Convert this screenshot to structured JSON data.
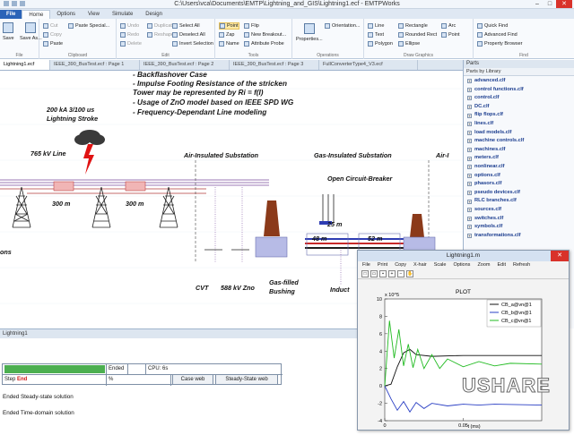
{
  "window": {
    "title": "C:\\Users\\vca\\Documents\\EMTP\\Lightning_and_GIS\\Lightning1.ecf - EMTPWorks",
    "controls": [
      "–",
      "□",
      "✕"
    ]
  },
  "ribbon": {
    "tabs": [
      "File",
      "Home",
      "Options",
      "View",
      "Simulate",
      "Design"
    ],
    "file_group": {
      "save": "Save",
      "save_as": "Save As...",
      "label": "File"
    },
    "clipboard": {
      "cut": "Cut",
      "copy": "Copy",
      "paste": "Paste",
      "paste_special": "Paste Special...",
      "label": "Clipboard"
    },
    "edit": {
      "undo": "Undo",
      "redo": "Redo",
      "delete": "Delete",
      "duplicate": "Duplicate",
      "reshape": "Reshape",
      "select_all": "Select All",
      "deselect_all": "Deselect All",
      "invert_selection": "Invert Selection",
      "label": "Edit"
    },
    "tools": {
      "point": "Point",
      "zap": "Zap",
      "name": "Name",
      "flip": "Flip",
      "rotate": "Rotate",
      "new_breakout": "New Breakout...",
      "attribute_probe": "Attribute Probe",
      "label": "Tools"
    },
    "operations": {
      "properties": "Properties...",
      "orientation": "Orientation...",
      "label": "Operations"
    },
    "draw": {
      "line": "Line",
      "text": "Text",
      "polygon": "Polygon",
      "rectangle": "Rectangle",
      "rounded_rect": "Rounded Rect",
      "ellipse": "Ellipse",
      "arc": "Arc",
      "point": "Point",
      "label": "Draw Graphics"
    },
    "find": {
      "quick_find": "Quick Find",
      "advanced_find": "Advanced Find",
      "property_browser": "Property Browser",
      "label": "Find"
    }
  },
  "doc_tabs": [
    "Lightning1.ecf",
    "IEEE_390_BusTest.ecf : Page 1",
    "IEEE_390_BusTest.ecf : Page 2",
    "IEEE_390_BusTest.ecf : Page 3",
    "FullConverterType4_V3.ecf"
  ],
  "canvas": {
    "notes": [
      "- Backflashover Case",
      "- Impulse Footing Resistance of the stricken",
      "  Tower may be represented by Ri = f(I)",
      "- Usage of ZnO model based on IEEE SPD WG",
      "- Frequency-Dependant Line modeling"
    ],
    "stroke_label": [
      "200 kA 3/100 us",
      "Lightning Stroke"
    ],
    "line_label": "765 kV Line",
    "air_sub": "Air-Insulated Substation",
    "gas_sub": "Gas-Insulated Substation",
    "air_right": "Air-I",
    "breaker": "Open Circuit-Breaker",
    "span1": "300 m",
    "span2": "300 m",
    "len_25": "25 m",
    "len_48": "48 m",
    "len_52": "52 m",
    "cvt": "CVT",
    "zno": "588 kV Zno",
    "bushing": [
      "Gas-filled",
      "Bushing"
    ],
    "induct": "Induct",
    "ons": "ons"
  },
  "parts": {
    "title": "Parts",
    "subtitle": "Parts by Library",
    "items": [
      "advanced.clf",
      "control functions.clf",
      "control.clf",
      "DC.clf",
      "flip flops.clf",
      "lines.clf",
      "load models.clf",
      "machine controls.clf",
      "machines.clf",
      "meters.clf",
      "nonlinear.clf",
      "options.clf",
      "phasors.clf",
      "pseudo devices.clf",
      "RLC branches.clf",
      "sources.clf",
      "switches.clf",
      "symbols.clf",
      "transformations.clf"
    ]
  },
  "bottom": {
    "title": "Lightning1",
    "ended": "Ended",
    "cpu": "CPU: 6s",
    "step_label": "Step",
    "step_value": "End",
    "percent": "%",
    "progress": 1.0,
    "case_web": "Case web",
    "steady_web": "Steady-State web",
    "log": [
      "Ended Steady-state solution",
      "Ended Time-domain solution"
    ]
  },
  "plot_window": {
    "title": "Lightning1.m",
    "menu": [
      "File",
      "Print",
      "Copy",
      "X-hair",
      "Scale",
      "Options",
      "Zoom",
      "Edit",
      "Refresh"
    ],
    "tools": [
      "new",
      "open",
      "save",
      "zoom-in",
      "zoom-out",
      "pan"
    ]
  },
  "chart_data": {
    "type": "line",
    "title": "PLOT",
    "xlabel": "t (ms)",
    "ylabel": "",
    "y_exponent": "x 10^5",
    "xlim": [
      0,
      0.1
    ],
    "ylim": [
      -4,
      10
    ],
    "x_ticks": [
      "0",
      "0.05"
    ],
    "y_ticks": [
      "10",
      "8",
      "6",
      "4",
      "2",
      "0",
      "-2",
      "-4"
    ],
    "grid": false,
    "legend": "top-right",
    "series": [
      {
        "name": "CB_a@vn@1",
        "color": "#111111",
        "x": [
          0,
          0.004,
          0.008,
          0.012,
          0.016,
          0.02,
          0.03,
          0.05,
          0.07,
          0.1
        ],
        "values": [
          0,
          0.2,
          2.2,
          3.8,
          4.2,
          3.6,
          3.4,
          3.5,
          3.5,
          3.5
        ]
      },
      {
        "name": "CB_b@vn@1",
        "color": "#2a3fc4",
        "x": [
          0,
          0.004,
          0.008,
          0.012,
          0.016,
          0.02,
          0.025,
          0.03,
          0.04,
          0.05,
          0.06,
          0.07,
          0.1
        ],
        "values": [
          0,
          -1.5,
          -2.8,
          -1.8,
          -3.0,
          -1.9,
          -2.6,
          -2.0,
          -2.3,
          -2.1,
          -2.2,
          -2.1,
          -2.2
        ]
      },
      {
        "name": "CB_c@vn@1",
        "color": "#22bb22",
        "x": [
          0,
          0.003,
          0.006,
          0.009,
          0.012,
          0.015,
          0.018,
          0.021,
          0.025,
          0.03,
          0.035,
          0.04,
          0.05,
          0.06,
          0.07,
          0.08,
          0.1
        ],
        "values": [
          0,
          7.5,
          3.2,
          6.5,
          2.3,
          4.8,
          2.1,
          4.2,
          2.0,
          3.6,
          2.0,
          3.1,
          2.2,
          2.8,
          2.3,
          2.6,
          2.5
        ]
      }
    ]
  }
}
